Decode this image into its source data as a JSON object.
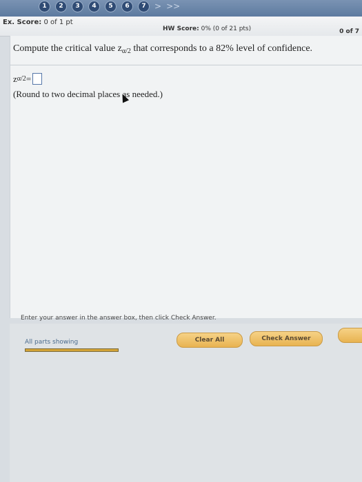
{
  "nav": {
    "questions": [
      "1",
      "2",
      "3",
      "4",
      "5",
      "6",
      "7"
    ],
    "next_arrow": ">",
    "last_arrow": ">>"
  },
  "scores": {
    "ex_label": "Ex. Score:",
    "ex_value": "0 of 1 pt",
    "hw_label": "HW Score:",
    "hw_value": "0% (0 of 21 pts)",
    "progress": "0 of 7"
  },
  "question": {
    "prefix": "Compute the critical value z",
    "subscript": "α/2",
    "suffix": " that corresponds to a 82% level of confidence."
  },
  "answer": {
    "var": "z",
    "subscript": "α/2",
    "equals": "=",
    "value": ""
  },
  "hint": "(Round to two decimal places as needed.)",
  "instructions": "Enter your answer in the answer box, then click Check Answer.",
  "footer": {
    "parts_label": "All parts showing",
    "clear_label": "Clear All",
    "check_label": "Check Answer"
  },
  "colors": {
    "button": "#e8b351",
    "nav_circle": "#2f4b74",
    "answer_border": "#5576a8"
  }
}
